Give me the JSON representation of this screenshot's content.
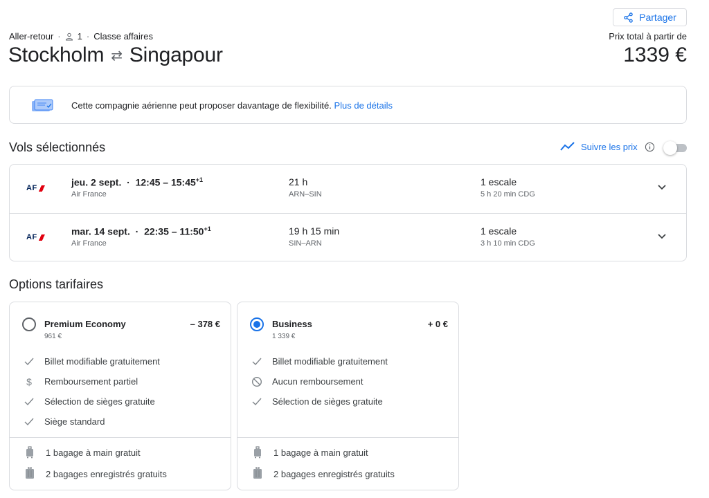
{
  "header": {
    "share_label": "Partager",
    "trip_type": "Aller-retour",
    "passengers": "1",
    "cabin_class": "Classe affaires",
    "origin": "Stockholm",
    "destination": "Singapour",
    "price_label": "Prix total à partir de",
    "price_total": "1339 €"
  },
  "banner": {
    "text": "Cette compagnie aérienne peut proposer davantage de flexibilité.",
    "link": "Plus de détails"
  },
  "selected_flights": {
    "title": "Vols sélectionnés",
    "track_label": "Suivre les prix",
    "track_enabled": false,
    "flights": [
      {
        "logo_text": "AF",
        "date": "jeu. 2 sept.",
        "times": "12:45 – 15:45",
        "day_offset": "+1",
        "airline": "Air France",
        "duration": "21 h",
        "route": "ARN–SIN",
        "stops": "1 escale",
        "layover": "5 h 20 min CDG"
      },
      {
        "logo_text": "AF",
        "date": "mar. 14 sept.",
        "times": "22:35 – 11:50",
        "day_offset": "+1",
        "airline": "Air France",
        "duration": "19 h 15 min",
        "route": "SIN–ARN",
        "stops": "1 escale",
        "layover": "3 h 10 min CDG"
      }
    ]
  },
  "fare_options": {
    "title": "Options tarifaires",
    "cards": [
      {
        "name": "Premium Economy",
        "price": "961 €",
        "delta": "– 378 €",
        "selected": false,
        "features": [
          {
            "icon": "check-icon",
            "label": "Billet modifiable gratuitement"
          },
          {
            "icon": "dollar-icon",
            "label": "Remboursement partiel"
          },
          {
            "icon": "check-icon",
            "label": "Sélection de sièges gratuite"
          },
          {
            "icon": "check-icon",
            "label": "Siège standard"
          }
        ],
        "baggage": [
          {
            "icon": "carry-on-bag-icon",
            "label": "1 bagage à main gratuit"
          },
          {
            "icon": "checked-bag-icon",
            "label": "2 bagages enregistrés gratuits"
          }
        ]
      },
      {
        "name": "Business",
        "price": "1 339 €",
        "delta": "+ 0 €",
        "selected": true,
        "features": [
          {
            "icon": "check-icon",
            "label": "Billet modifiable gratuitement"
          },
          {
            "icon": "no-refund-icon",
            "label": "Aucun remboursement"
          },
          {
            "icon": "check-icon",
            "label": "Sélection de sièges gratuite"
          }
        ],
        "baggage": [
          {
            "icon": "carry-on-bag-icon",
            "label": "1 bagage à main gratuit"
          },
          {
            "icon": "checked-bag-icon",
            "label": "2 bagages enregistrés gratuits"
          }
        ]
      }
    ]
  },
  "colors": {
    "accent": "#1a73e8",
    "border": "#dadce0",
    "text_primary": "#202124",
    "text_secondary": "#5f6368",
    "airline_blue": "#002157",
    "airline_red": "#e1000f"
  }
}
